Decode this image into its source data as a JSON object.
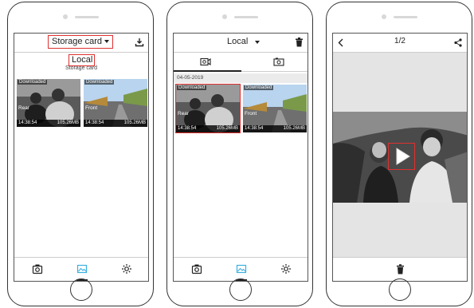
{
  "colors": {
    "highlight": "#e03030",
    "active_tab": "#3bb0e0",
    "icon": "#222222"
  },
  "screen1": {
    "title": "Storage card",
    "dropdown_options": [
      "Local",
      "Storage card"
    ],
    "download_icon": "download-icon",
    "thumbs": [
      {
        "badge": "Downloaded",
        "camera": "Rear",
        "time": "14:38:54",
        "size": "105.26MB"
      },
      {
        "badge": "Downloaded",
        "camera": "Front",
        "time": "14:38:54",
        "size": "105.26MB"
      }
    ],
    "tabs": [
      "camera-icon",
      "gallery-icon",
      "settings-icon"
    ]
  },
  "screen2": {
    "title": "Local",
    "tabs_top": [
      "video-camera-icon",
      "photo-camera-icon"
    ],
    "date": "04-05-2019",
    "thumbs": [
      {
        "badge": "Downloaded",
        "camera": "Rear",
        "time": "14:38:54",
        "size": "105.26MB"
      },
      {
        "badge": "Downloaded",
        "camera": "Front",
        "time": "14:38:54",
        "size": "105.26MB"
      }
    ],
    "tabs": [
      "camera-icon",
      "gallery-icon",
      "settings-icon"
    ]
  },
  "screen3": {
    "page_indicator": "1/2",
    "icons": [
      "back-icon",
      "share-icon",
      "play-icon",
      "trash-icon"
    ]
  }
}
